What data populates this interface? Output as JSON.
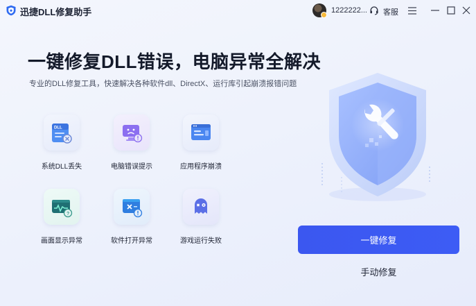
{
  "app": {
    "title": "迅捷DLL修复助手"
  },
  "header": {
    "username": "1222222...",
    "support_label": "客服"
  },
  "hero": {
    "headline": "一键修复DLL错误，电脑异常全解决",
    "subline": "专业的DLL修复工具，快速解决各种软件dll、DirectX、运行库引起崩溃报错问题"
  },
  "features": [
    {
      "label": "系统DLL丢失",
      "icon": "dll-missing-icon"
    },
    {
      "label": "电脑错误提示",
      "icon": "error-prompt-icon"
    },
    {
      "label": "应用程序崩溃",
      "icon": "app-crash-icon"
    },
    {
      "label": "画面显示异常",
      "icon": "display-error-icon"
    },
    {
      "label": "软件打开异常",
      "icon": "software-open-icon"
    },
    {
      "label": "游戏运行失败",
      "icon": "game-fail-icon"
    }
  ],
  "actions": {
    "primary_label": "一键修复",
    "secondary_label": "手动修复"
  },
  "colors": {
    "accent": "#3d5cf5",
    "background": "#eef2fc"
  }
}
